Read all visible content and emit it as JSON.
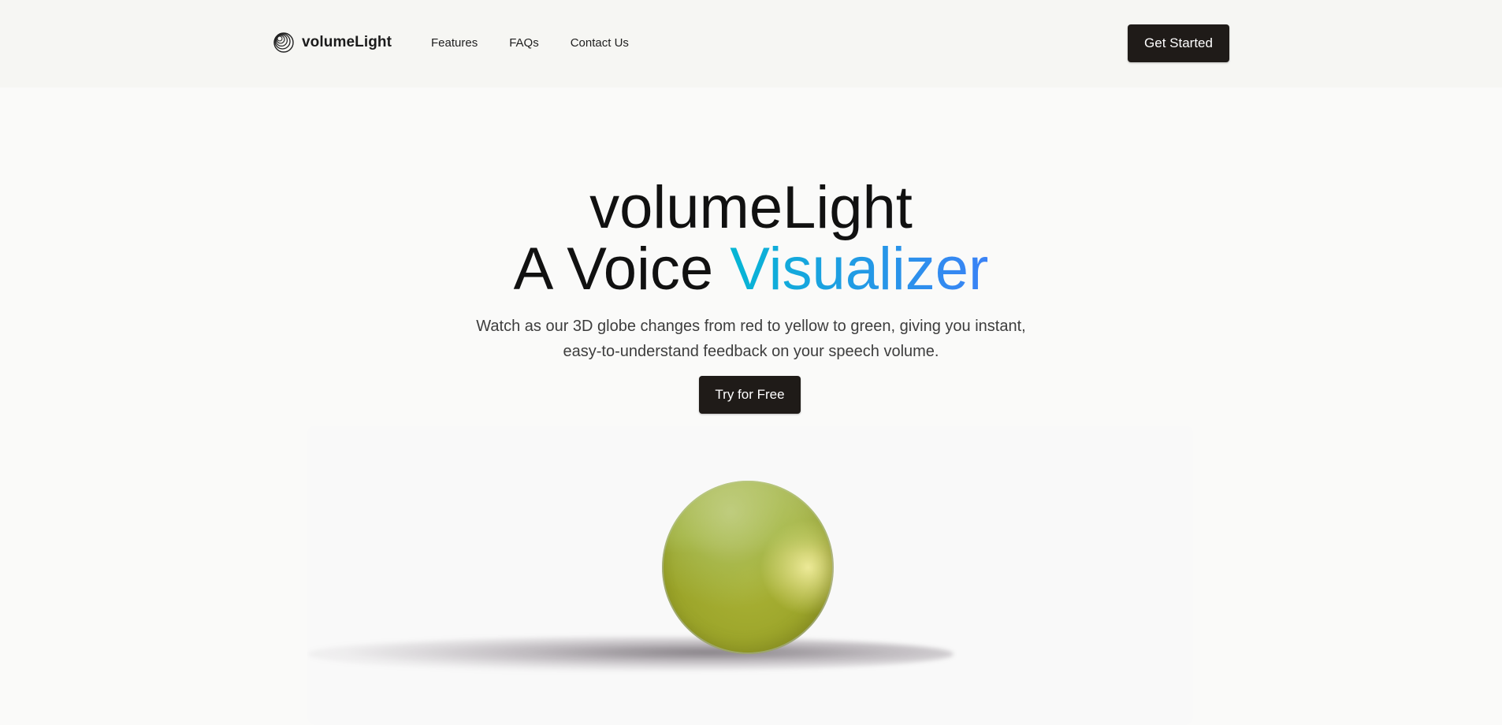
{
  "header": {
    "brand": "volumeLight",
    "logo_icon": "concentric-rings-icon",
    "nav": [
      {
        "label": "Features"
      },
      {
        "label": "FAQs"
      },
      {
        "label": "Contact Us"
      }
    ],
    "cta_label": "Get Started"
  },
  "hero": {
    "title_line1": "volumeLight",
    "title_line2_prefix": "A Voice ",
    "title_line2_accent": "Visualizer",
    "subtitle": "Watch as our 3D globe changes from red to yellow to green, giving you instant, easy-to-understand feedback on your speech volume.",
    "cta_label": "Try for Free"
  },
  "colors": {
    "dark_button": "#1f1b18",
    "accent_gradient_start": "#06b6d4",
    "accent_gradient_end": "#3b82f6",
    "globe": "#a3ab2e"
  }
}
